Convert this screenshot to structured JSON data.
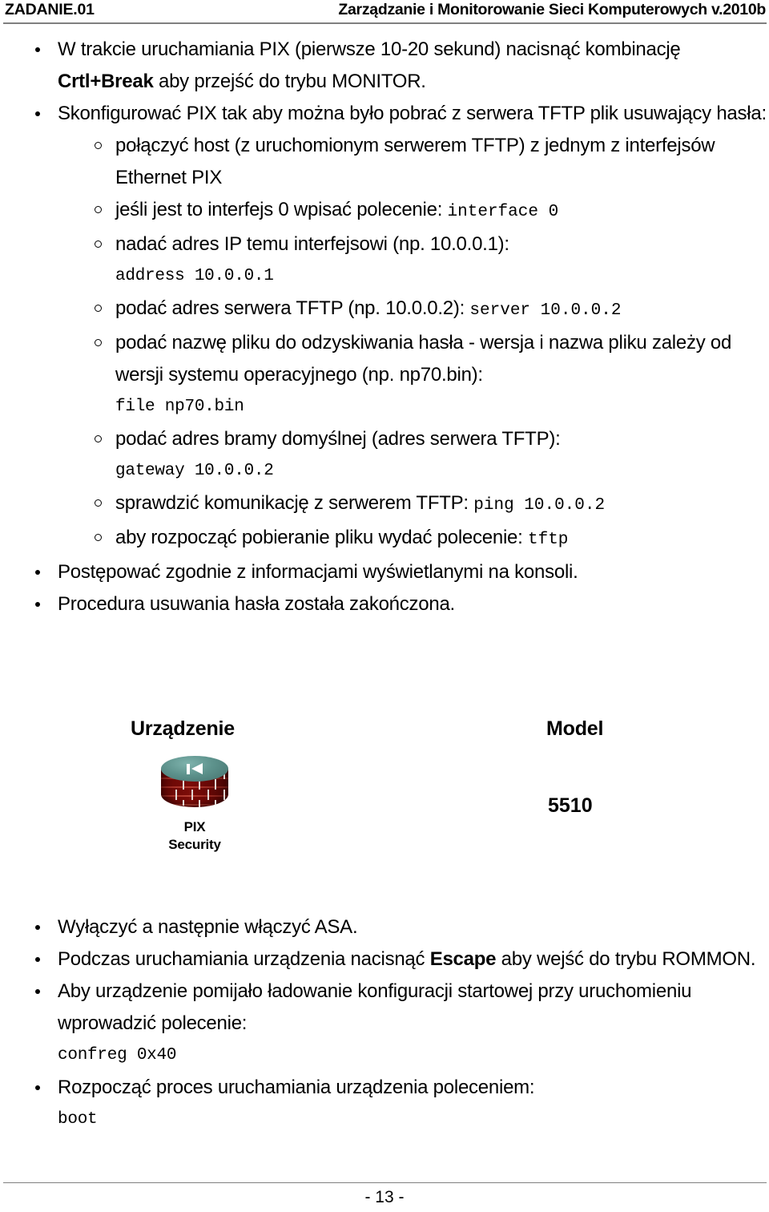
{
  "header": {
    "left": "ZADANIE.01",
    "right": "Zarządzanie i Monitorowanie Sieci Komputerowych v.2010b"
  },
  "body": {
    "b1_part1": "W trakcie uruchamiania PIX (pierwsze 10-20 sekund) nacisnąć kombinację ",
    "b1_bold": "Crtl+Break",
    "b1_part2": " aby przejść do trybu MONITOR.",
    "b2_text": "Skonfigurować PIX tak aby można było pobrać z serwera TFTP plik usuwający hasła:",
    "sub1": "połączyć host (z uruchomionym serwerem TFTP) z jednym z interfejsów Ethernet PIX",
    "sub2_text": "jeśli jest to interfejs 0 wpisać polecenie: ",
    "sub2_cmd": "interface 0",
    "sub3_text": "nadać adres IP temu interfejsowi (np. 10.0.0.1):",
    "sub3_cmd": "address 10.0.0.1",
    "sub4_text": "podać adres serwera TFTP (np. 10.0.0.2): ",
    "sub4_cmd": "server 10.0.0.2",
    "sub5_text": "podać nazwę pliku do odzyskiwania hasła - wersja i nazwa pliku zależy od wersji systemu operacyjnego (np. np70.bin):",
    "sub5_cmd": "file np70.bin",
    "sub6_text": "podać adres bramy domyślnej (adres serwera TFTP):",
    "sub6_cmd": "gateway 10.0.0.2",
    "sub7_text": "sprawdzić komunikację z serwerem TFTP: ",
    "sub7_cmd": "ping 10.0.0.2",
    "sub8_text": "aby rozpocząć pobieranie pliku wydać polecenie: ",
    "sub8_cmd": "tftp",
    "b3_text": "Postępować zgodnie z informacjami wyświetlanymi na konsoli.",
    "b4_text": "Procedura usuwania hasła została zakończona."
  },
  "device_table": {
    "col_device": "Urządzenie",
    "col_model": "Model",
    "device_icon_name": "pix-security-firewall-icon",
    "device_caption_line1": "PIX",
    "device_caption_line2": "Security",
    "model_value": "5510",
    "top_color": "#5d928c",
    "brick_color": "#a82e26"
  },
  "body_lower": {
    "b5_text": "Wyłączyć a następnie włączyć ASA.",
    "b6_part1": "Podczas uruchamiania urządzenia nacisnąć ",
    "b6_bold": "Escape",
    "b6_part2": " aby wejść do trybu ROMMON.",
    "b7_text": "Aby urządzenie pomijało ładowanie konfiguracji startowej przy uruchomieniu wprowadzić polecenie:",
    "b7_cmd": "confreg 0x40",
    "b8_text": "Rozpocząć proces uruchamiania urządzenia poleceniem:",
    "b8_cmd": "boot"
  },
  "footer": {
    "page_number": "- 13 -"
  }
}
